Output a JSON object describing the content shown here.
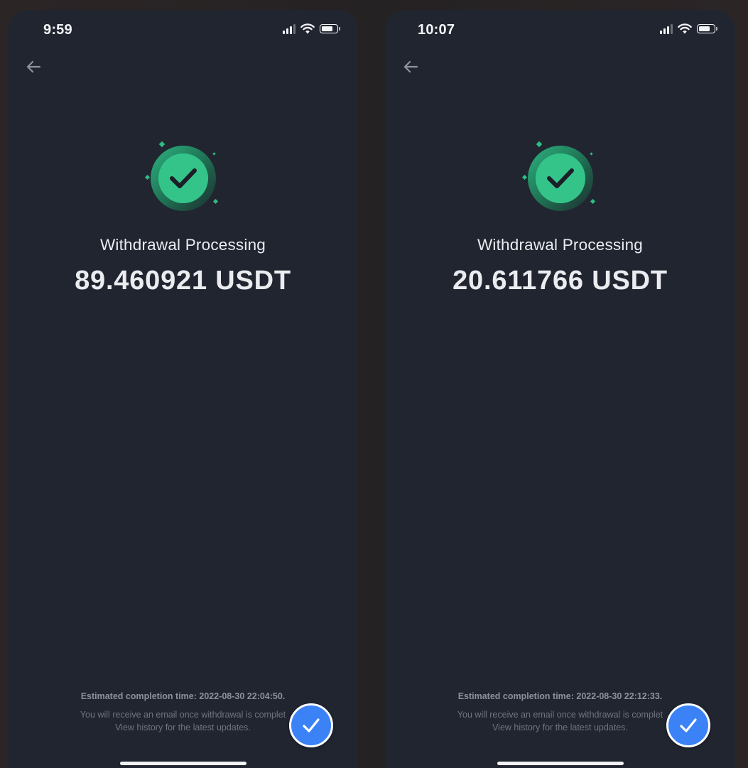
{
  "screens": [
    {
      "status_time": "9:59",
      "title": "Withdrawal Processing",
      "amount": "89.460921 USDT",
      "estimated_completion": "Estimated completion time: 2022-08-30 22:04:50.",
      "email_note": "You will receive an email once withdrawal is complet",
      "history_note": "View history for the latest updates."
    },
    {
      "status_time": "10:07",
      "title": "Withdrawal Processing",
      "amount": "20.611766 USDT",
      "estimated_completion": "Estimated completion time: 2022-08-30 22:12:33.",
      "email_note": "You will receive an email once withdrawal is complet",
      "history_note": "View history for the latest updates."
    }
  ],
  "icons": {
    "back": "back-arrow-icon",
    "success": "success-check-icon",
    "signal": "cellular-signal-icon",
    "wifi": "wifi-icon",
    "battery": "battery-icon",
    "verified": "verified-check-icon"
  },
  "colors": {
    "screen_bg": "#212530",
    "success_green": "#2ebd85",
    "verified_blue": "#3b82f6",
    "text_primary": "#eaecef",
    "text_secondary": "#8c919c"
  }
}
